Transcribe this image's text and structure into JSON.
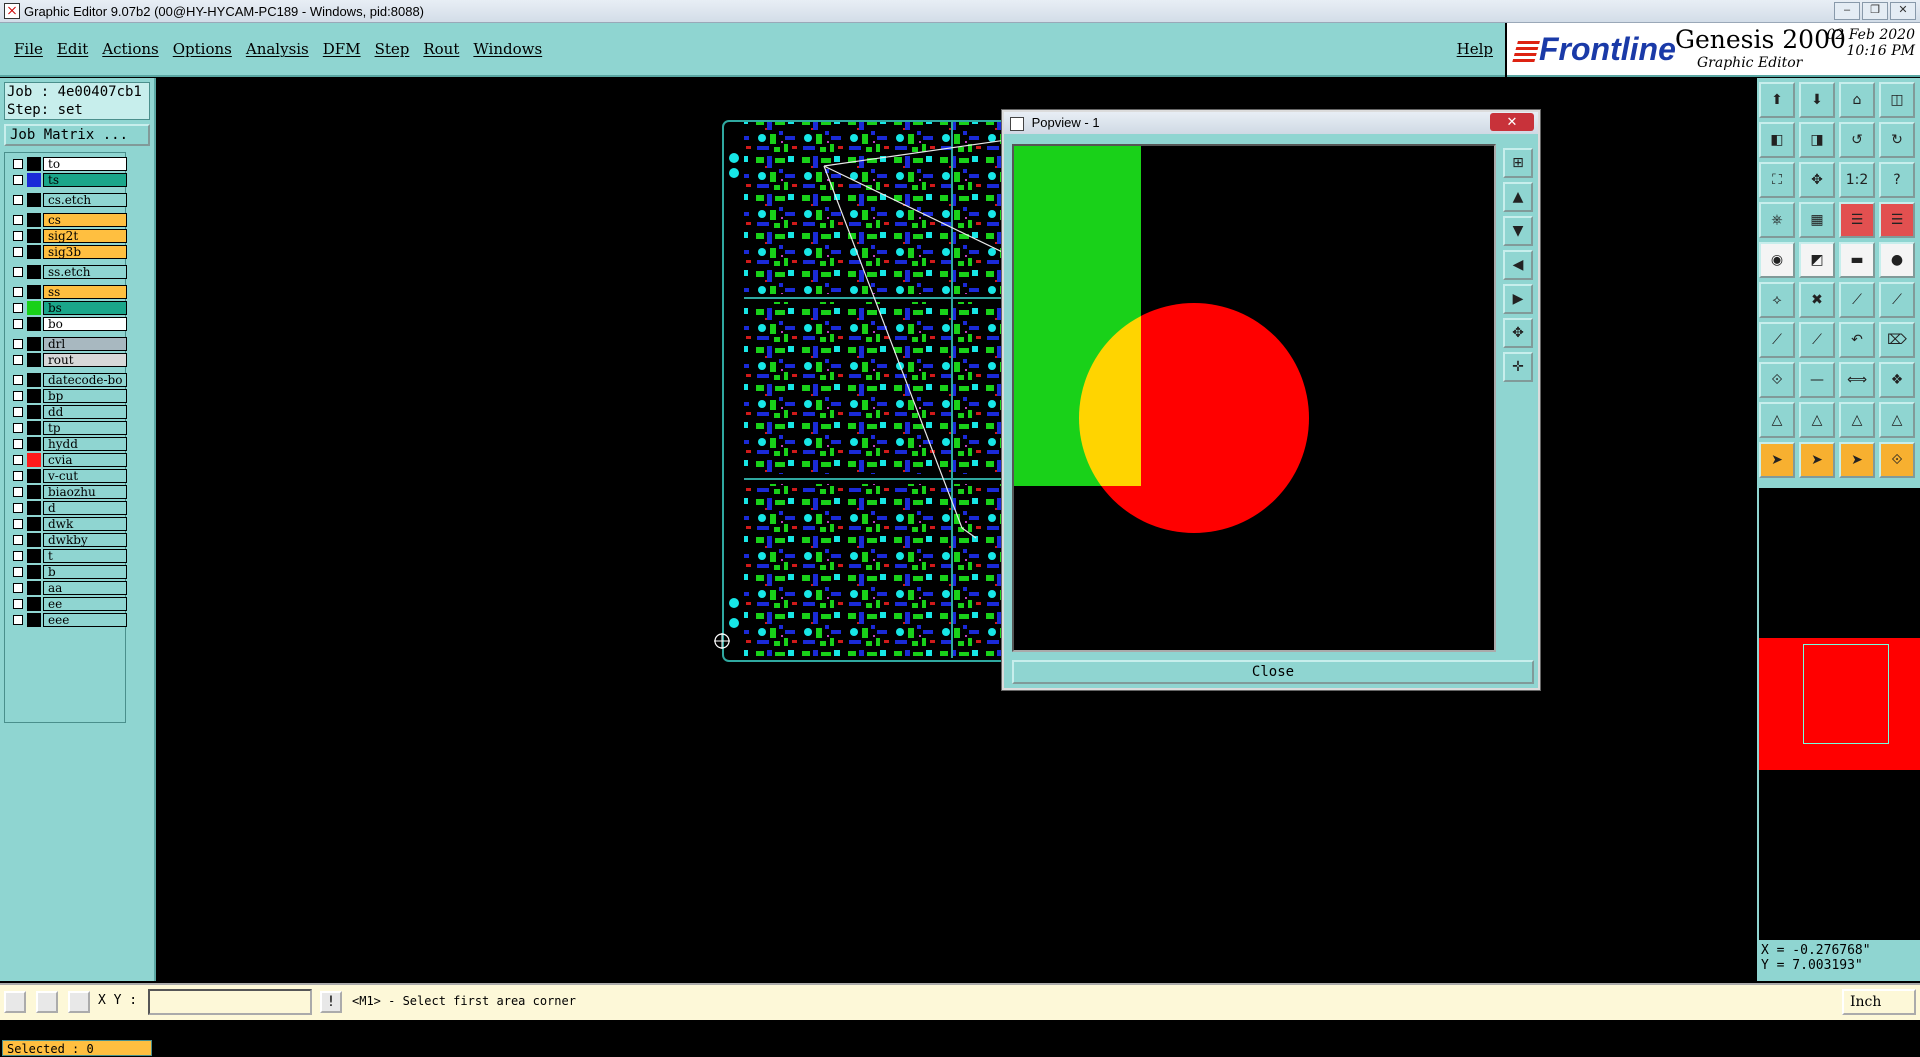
{
  "window": {
    "title": "Graphic Editor 9.07b2 (00@HY-HYCAM-PC189 - Windows, pid:8088)"
  },
  "menu": {
    "items": [
      "File",
      "Edit",
      "Actions",
      "Options",
      "Analysis",
      "DFM",
      "Step",
      "Rout",
      "Windows"
    ],
    "help": "Help"
  },
  "brand": {
    "logo": "Frontline",
    "product": "Genesis 2000",
    "subtitle": "Graphic Editor",
    "date": "02 Feb 2020",
    "time": "10:16 PM"
  },
  "job": {
    "job_line": "Job : 4e00407cb1",
    "step_line": "Step: set",
    "matrix_button": "Job Matrix ..."
  },
  "layers": [
    {
      "name": "to",
      "bg": "#ffffff",
      "swatch": "#000000"
    },
    {
      "name": "ts",
      "bg": "#1aa68a",
      "swatch": "#1a2ad8"
    },
    {
      "name": "cs.etch",
      "bg": "#8fd5d1",
      "swatch": "#000000"
    },
    {
      "name": "cs",
      "bg": "#ffbf40",
      "swatch": "#000000"
    },
    {
      "name": "sig2t",
      "bg": "#ffbf40",
      "swatch": "#000000"
    },
    {
      "name": "sig3b",
      "bg": "#ffbf40",
      "swatch": "#000000"
    },
    {
      "name": "ss.etch",
      "bg": "#8fd5d1",
      "swatch": "#000000"
    },
    {
      "name": "ss",
      "bg": "#ffbf40",
      "swatch": "#000000"
    },
    {
      "name": "bs",
      "bg": "#1aa68a",
      "swatch": "#19d119"
    },
    {
      "name": "bo",
      "bg": "#ffffff",
      "swatch": "#000000"
    },
    {
      "name": "drl",
      "bg": "#a8b8c0",
      "swatch": "#000000"
    },
    {
      "name": "rout",
      "bg": "#d8d8d8",
      "swatch": "#000000"
    },
    {
      "name": "datecode-bo",
      "bg": "#8fd5d1",
      "swatch": "#000000"
    },
    {
      "name": "bp",
      "bg": "#8fd5d1",
      "swatch": "#000000"
    },
    {
      "name": "dd",
      "bg": "#8fd5d1",
      "swatch": "#000000"
    },
    {
      "name": "tp",
      "bg": "#8fd5d1",
      "swatch": "#000000"
    },
    {
      "name": "hydd",
      "bg": "#8fd5d1",
      "swatch": "#000000"
    },
    {
      "name": "cvia",
      "bg": "#8fd5d1",
      "swatch": "#ff1a1a"
    },
    {
      "name": "v-cut",
      "bg": "#8fd5d1",
      "swatch": "#000000"
    },
    {
      "name": "biaozhu",
      "bg": "#8fd5d1",
      "swatch": "#000000"
    },
    {
      "name": "d",
      "bg": "#8fd5d1",
      "swatch": "#000000"
    },
    {
      "name": "dwk",
      "bg": "#8fd5d1",
      "swatch": "#000000"
    },
    {
      "name": "dwkby",
      "bg": "#8fd5d1",
      "swatch": "#000000"
    },
    {
      "name": "t",
      "bg": "#8fd5d1",
      "swatch": "#000000"
    },
    {
      "name": "b",
      "bg": "#8fd5d1",
      "swatch": "#000000"
    },
    {
      "name": "aa",
      "bg": "#8fd5d1",
      "swatch": "#000000"
    },
    {
      "name": "ee",
      "bg": "#8fd5d1",
      "swatch": "#000000"
    },
    {
      "name": "eee",
      "bg": "#8fd5d1",
      "swatch": "#000000"
    }
  ],
  "selected": "Selected : 0",
  "popview": {
    "title": "Popview - 1",
    "close_x": "✕",
    "close_button": "Close"
  },
  "coords": {
    "x": "X = -0.276768\"",
    "y": "Y = 7.003193\""
  },
  "status": {
    "xy_label": "X Y :",
    "xy_value": "",
    "excl": "!",
    "message": "<M1> - Select first area corner",
    "unit": "Inch"
  },
  "colors": {
    "panel": "#8fd5d1",
    "pcb_green": "#19d119",
    "pcb_blue": "#1a2ad8",
    "pcb_cyan": "#17e6e6",
    "red": "#ff0000",
    "yellow": "#ffd400"
  }
}
